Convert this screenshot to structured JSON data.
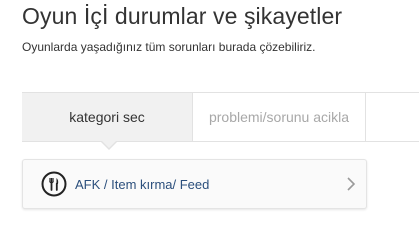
{
  "page": {
    "title": "Oyun İçİ durumlar ve şikayetler",
    "subtitle": "Oyunlarda yaşadığınız tüm sorunları burada çözebiliriz."
  },
  "steps": [
    {
      "label": "kategori sec",
      "active": true
    },
    {
      "label": "problemi/sorunu acikla",
      "active": false
    }
  ],
  "categories": [
    {
      "label": "AFK / Item kırma/ Feed",
      "icon": "fork-knife-icon",
      "arrow": "chevron-right-icon"
    }
  ],
  "colors": {
    "active_step_bg": "#f1f1f1",
    "inactive_step_text": "#a8a8a8",
    "category_text": "#2b4f7c"
  }
}
